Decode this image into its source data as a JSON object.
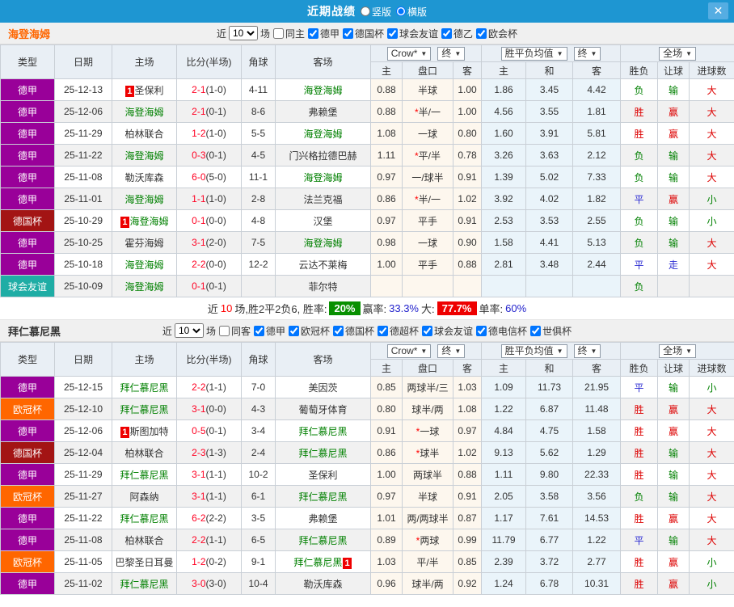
{
  "topbar": {
    "title": "近期战绩",
    "layout_options": [
      {
        "label": "竖版",
        "selected": false
      },
      {
        "label": "横版",
        "selected": true
      }
    ],
    "close_label": "✕"
  },
  "table_headers": {
    "type": "类型",
    "date": "日期",
    "home": "主场",
    "score": "比分(半场)",
    "corner": "角球",
    "away": "客场",
    "odds_source": "Crow*",
    "final1": "终",
    "avg_label": "胜平负均值",
    "final2": "终",
    "scope": "全场",
    "sub_home_odds": "主",
    "sub_handicap": "盘口",
    "sub_away_odds": "客",
    "sub_avg_home": "主",
    "sub_avg_draw": "和",
    "sub_avg_away": "客",
    "sub_wdl": "胜负",
    "sub_handicap_result": "让球",
    "sub_goals": "进球数"
  },
  "palette": {
    "titlebar_blue": "#1e96d2",
    "type_colors": {
      "德甲": "#990099",
      "德国杯": "#a31414",
      "球会友谊": "#1fada5",
      "欧冠杯": "#ff6600"
    },
    "result_colors": {
      "胜": "#dd0000",
      "平": "#2a2ad2",
      "负": "#008000",
      "赢": "#dd0000",
      "输": "#008000",
      "走": "#2a2ad2",
      "大": "#dd0000",
      "小": "#008000"
    },
    "team_highlight_green": "#008000",
    "score_red": "#ff0022",
    "badge_red": "#ee0000"
  },
  "sections": [
    {
      "team": "海登海姆",
      "team_color": "#ff6600",
      "filter": {
        "near_label": "近",
        "count": "10",
        "games_label": "场",
        "same_label": "同主",
        "same_checked": false,
        "leagues": [
          {
            "label": "德甲",
            "checked": true
          },
          {
            "label": "德国杯",
            "checked": true
          },
          {
            "label": "球会友谊",
            "checked": true
          },
          {
            "label": "德乙",
            "checked": true
          },
          {
            "label": "欧会杯",
            "checked": true
          }
        ]
      },
      "rows": [
        {
          "type": "德甲",
          "date": "25-12-13",
          "home": "圣保利",
          "home_green": false,
          "home_badge": "1",
          "score": "2-1",
          "half": "(1-0)",
          "corner": "4-11",
          "away": "海登海姆",
          "away_green": true,
          "away_badge": null,
          "odds": [
            "0.88",
            "半球",
            "1.00"
          ],
          "avg": [
            "1.86",
            "3.45",
            "4.42"
          ],
          "results": [
            "负",
            "输",
            "大"
          ]
        },
        {
          "type": "德甲",
          "date": "25-12-06",
          "home": "海登海姆",
          "home_green": true,
          "home_badge": null,
          "score": "2-1",
          "half": "(0-1)",
          "corner": "8-6",
          "away": "弗赖堡",
          "away_green": false,
          "away_badge": null,
          "odds": [
            "0.88",
            "*半/一",
            "1.00"
          ],
          "avg": [
            "4.56",
            "3.55",
            "1.81"
          ],
          "results": [
            "胜",
            "赢",
            "大"
          ]
        },
        {
          "type": "德甲",
          "date": "25-11-29",
          "home": "柏林联合",
          "home_green": false,
          "home_badge": null,
          "score": "1-2",
          "half": "(1-0)",
          "corner": "5-5",
          "away": "海登海姆",
          "away_green": true,
          "away_badge": null,
          "odds": [
            "1.08",
            "一球",
            "0.80"
          ],
          "avg": [
            "1.60",
            "3.91",
            "5.81"
          ],
          "results": [
            "胜",
            "赢",
            "大"
          ]
        },
        {
          "type": "德甲",
          "date": "25-11-22",
          "home": "海登海姆",
          "home_green": true,
          "home_badge": null,
          "score": "0-3",
          "half": "(0-1)",
          "corner": "4-5",
          "away": "门兴格拉德巴赫",
          "away_green": false,
          "away_badge": null,
          "odds": [
            "1.11",
            "*平/半",
            "0.78"
          ],
          "avg": [
            "3.26",
            "3.63",
            "2.12"
          ],
          "results": [
            "负",
            "输",
            "大"
          ]
        },
        {
          "type": "德甲",
          "date": "25-11-08",
          "home": "勒沃库森",
          "home_green": false,
          "home_badge": null,
          "score": "6-0",
          "half": "(5-0)",
          "corner": "11-1",
          "away": "海登海姆",
          "away_green": true,
          "away_badge": null,
          "odds": [
            "0.97",
            "一/球半",
            "0.91"
          ],
          "avg": [
            "1.39",
            "5.02",
            "7.33"
          ],
          "results": [
            "负",
            "输",
            "大"
          ]
        },
        {
          "type": "德甲",
          "date": "25-11-01",
          "home": "海登海姆",
          "home_green": true,
          "home_badge": null,
          "score": "1-1",
          "half": "(1-0)",
          "corner": "2-8",
          "away": "法兰克福",
          "away_green": false,
          "away_badge": null,
          "odds": [
            "0.86",
            "*半/一",
            "1.02"
          ],
          "avg": [
            "3.92",
            "4.02",
            "1.82"
          ],
          "results": [
            "平",
            "赢",
            "小"
          ]
        },
        {
          "type": "德国杯",
          "date": "25-10-29",
          "home": "海登海姆",
          "home_green": true,
          "home_badge": "1",
          "score": "0-1",
          "half": "(0-0)",
          "corner": "4-8",
          "away": "汉堡",
          "away_green": false,
          "away_badge": null,
          "odds": [
            "0.97",
            "平手",
            "0.91"
          ],
          "avg": [
            "2.53",
            "3.53",
            "2.55"
          ],
          "results": [
            "负",
            "输",
            "小"
          ]
        },
        {
          "type": "德甲",
          "date": "25-10-25",
          "home": "霍芬海姆",
          "home_green": false,
          "home_badge": null,
          "score": "3-1",
          "half": "(2-0)",
          "corner": "7-5",
          "away": "海登海姆",
          "away_green": true,
          "away_badge": null,
          "odds": [
            "0.98",
            "一球",
            "0.90"
          ],
          "avg": [
            "1.58",
            "4.41",
            "5.13"
          ],
          "results": [
            "负",
            "输",
            "大"
          ]
        },
        {
          "type": "德甲",
          "date": "25-10-18",
          "home": "海登海姆",
          "home_green": true,
          "home_badge": null,
          "score": "2-2",
          "half": "(0-0)",
          "corner": "12-2",
          "away": "云达不莱梅",
          "away_green": false,
          "away_badge": null,
          "odds": [
            "1.00",
            "平手",
            "0.88"
          ],
          "avg": [
            "2.81",
            "3.48",
            "2.44"
          ],
          "results": [
            "平",
            "走",
            "大"
          ]
        },
        {
          "type": "球会友谊",
          "date": "25-10-09",
          "home": "海登海姆",
          "home_green": true,
          "home_badge": null,
          "score": "0-1",
          "half": "(0-1)",
          "corner": "",
          "away": "菲尔特",
          "away_green": false,
          "away_badge": null,
          "odds": [
            "",
            "",
            ""
          ],
          "avg": [
            "",
            "",
            ""
          ],
          "results": [
            "负",
            "",
            ""
          ]
        }
      ],
      "summary": {
        "near_label": "近",
        "count": "10",
        "record_text": "场,胜2平2负6, 胜率:",
        "win_rate_badge": "20%",
        "ying_label": "赢率:",
        "ying_value": "33.3%",
        "da_label": "大:",
        "da_badge": "77.7%",
        "dan_label": "单率:",
        "dan_value": "60%"
      }
    },
    {
      "team": "拜仁慕尼黑",
      "team_color": "#333333",
      "filter": {
        "near_label": "近",
        "count": "10",
        "games_label": "场",
        "same_label": "同客",
        "same_checked": false,
        "leagues": [
          {
            "label": "德甲",
            "checked": true
          },
          {
            "label": "欧冠杯",
            "checked": true
          },
          {
            "label": "德国杯",
            "checked": true
          },
          {
            "label": "德超杯",
            "checked": true
          },
          {
            "label": "球会友谊",
            "checked": true
          },
          {
            "label": "德电信杯",
            "checked": true
          },
          {
            "label": "世俱杯",
            "checked": true
          }
        ]
      },
      "rows": [
        {
          "type": "德甲",
          "date": "25-12-15",
          "home": "拜仁慕尼黑",
          "home_green": true,
          "home_badge": null,
          "score": "2-2",
          "half": "(1-1)",
          "corner": "7-0",
          "away": "美因茨",
          "away_green": false,
          "away_badge": null,
          "odds": [
            "0.85",
            "两球半/三",
            "1.03"
          ],
          "avg": [
            "1.09",
            "11.73",
            "21.95"
          ],
          "results": [
            "平",
            "输",
            "小"
          ]
        },
        {
          "type": "欧冠杯",
          "date": "25-12-10",
          "home": "拜仁慕尼黑",
          "home_green": true,
          "home_badge": null,
          "score": "3-1",
          "half": "(0-0)",
          "corner": "4-3",
          "away": "葡萄牙体育",
          "away_green": false,
          "away_badge": null,
          "odds": [
            "0.80",
            "球半/两",
            "1.08"
          ],
          "avg": [
            "1.22",
            "6.87",
            "11.48"
          ],
          "results": [
            "胜",
            "赢",
            "大"
          ]
        },
        {
          "type": "德甲",
          "date": "25-12-06",
          "home": "斯图加特",
          "home_green": false,
          "home_badge": "1",
          "score": "0-5",
          "half": "(0-1)",
          "corner": "3-4",
          "away": "拜仁慕尼黑",
          "away_green": true,
          "away_badge": null,
          "odds": [
            "0.91",
            "*一球",
            "0.97"
          ],
          "avg": [
            "4.84",
            "4.75",
            "1.58"
          ],
          "results": [
            "胜",
            "赢",
            "大"
          ]
        },
        {
          "type": "德国杯",
          "date": "25-12-04",
          "home": "柏林联合",
          "home_green": false,
          "home_badge": null,
          "score": "2-3",
          "half": "(1-3)",
          "corner": "2-4",
          "away": "拜仁慕尼黑",
          "away_green": true,
          "away_badge": null,
          "odds": [
            "0.86",
            "*球半",
            "1.02"
          ],
          "avg": [
            "9.13",
            "5.62",
            "1.29"
          ],
          "results": [
            "胜",
            "输",
            "大"
          ]
        },
        {
          "type": "德甲",
          "date": "25-11-29",
          "home": "拜仁慕尼黑",
          "home_green": true,
          "home_badge": null,
          "score": "3-1",
          "half": "(1-1)",
          "corner": "10-2",
          "away": "圣保利",
          "away_green": false,
          "away_badge": null,
          "odds": [
            "1.00",
            "两球半",
            "0.88"
          ],
          "avg": [
            "1.11",
            "9.80",
            "22.33"
          ],
          "results": [
            "胜",
            "输",
            "大"
          ]
        },
        {
          "type": "欧冠杯",
          "date": "25-11-27",
          "home": "阿森纳",
          "home_green": false,
          "home_badge": null,
          "score": "3-1",
          "half": "(1-1)",
          "corner": "6-1",
          "away": "拜仁慕尼黑",
          "away_green": true,
          "away_badge": null,
          "odds": [
            "0.97",
            "半球",
            "0.91"
          ],
          "avg": [
            "2.05",
            "3.58",
            "3.56"
          ],
          "results": [
            "负",
            "输",
            "大"
          ]
        },
        {
          "type": "德甲",
          "date": "25-11-22",
          "home": "拜仁慕尼黑",
          "home_green": true,
          "home_badge": null,
          "score": "6-2",
          "half": "(2-2)",
          "corner": "3-5",
          "away": "弗赖堡",
          "away_green": false,
          "away_badge": null,
          "odds": [
            "1.01",
            "两/两球半",
            "0.87"
          ],
          "avg": [
            "1.17",
            "7.61",
            "14.53"
          ],
          "results": [
            "胜",
            "赢",
            "大"
          ]
        },
        {
          "type": "德甲",
          "date": "25-11-08",
          "home": "柏林联合",
          "home_green": false,
          "home_badge": null,
          "score": "2-2",
          "half": "(1-1)",
          "corner": "6-5",
          "away": "拜仁慕尼黑",
          "away_green": true,
          "away_badge": null,
          "odds": [
            "0.89",
            "*两球",
            "0.99"
          ],
          "avg": [
            "11.79",
            "6.77",
            "1.22"
          ],
          "results": [
            "平",
            "输",
            "大"
          ]
        },
        {
          "type": "欧冠杯",
          "date": "25-11-05",
          "home": "巴黎圣日耳曼",
          "home_green": false,
          "home_badge": null,
          "score": "1-2",
          "half": "(0-2)",
          "corner": "9-1",
          "away": "拜仁慕尼黑",
          "away_green": true,
          "away_badge": "1",
          "odds": [
            "1.03",
            "平/半",
            "0.85"
          ],
          "avg": [
            "2.39",
            "3.72",
            "2.77"
          ],
          "results": [
            "胜",
            "赢",
            "小"
          ]
        },
        {
          "type": "德甲",
          "date": "25-11-02",
          "home": "拜仁慕尼黑",
          "home_green": true,
          "home_badge": null,
          "score": "3-0",
          "half": "(3-0)",
          "corner": "10-4",
          "away": "勒沃库森",
          "away_green": false,
          "away_badge": null,
          "odds": [
            "0.96",
            "球半/两",
            "0.92"
          ],
          "avg": [
            "1.24",
            "6.78",
            "10.31"
          ],
          "results": [
            "胜",
            "赢",
            "小"
          ]
        }
      ]
    }
  ]
}
